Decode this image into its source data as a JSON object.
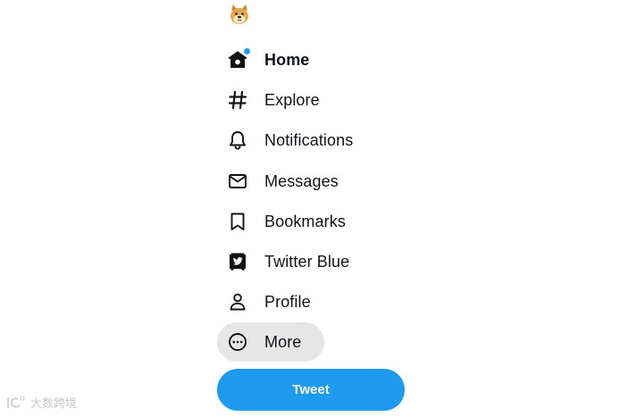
{
  "sidebar": {
    "logo_icon": "doge-avatar-icon",
    "items": [
      {
        "label": "Home",
        "icon": "home-icon",
        "active": true,
        "has_notification_dot": true
      },
      {
        "label": "Explore",
        "icon": "hashtag-icon"
      },
      {
        "label": "Notifications",
        "icon": "bell-icon"
      },
      {
        "label": "Messages",
        "icon": "envelope-icon"
      },
      {
        "label": "Bookmarks",
        "icon": "bookmark-icon"
      },
      {
        "label": "Twitter Blue",
        "icon": "twitter-blue-icon"
      },
      {
        "label": "Profile",
        "icon": "person-icon"
      },
      {
        "label": "More",
        "icon": "more-circle-icon",
        "hovered": true
      }
    ],
    "tweet_button_label": "Tweet"
  },
  "watermark": {
    "text": "大数跨境"
  },
  "colors": {
    "accent": "#1d9bf0",
    "text": "#0f1419",
    "hover_bg": "#e6e6e6",
    "background": "#ffffff"
  }
}
